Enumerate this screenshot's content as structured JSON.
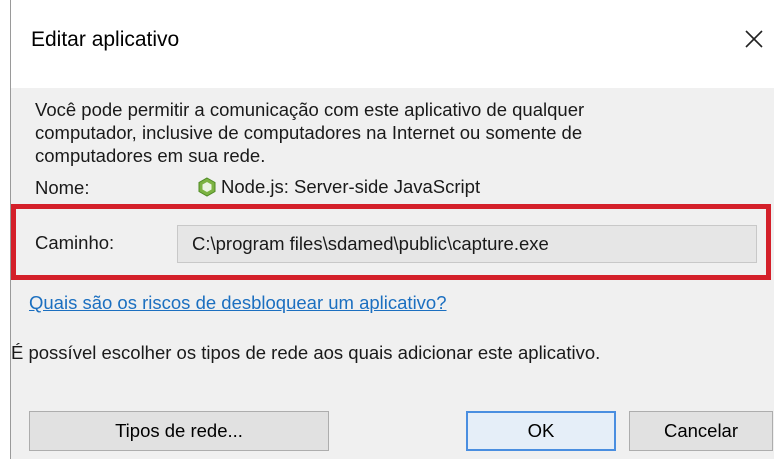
{
  "window": {
    "title": "Editar aplicativo",
    "close_icon": "close-icon"
  },
  "description": {
    "lines": [
      "Você pode permitir a comunicação com este aplicativo de qualquer",
      "computador, inclusive de computadores na Internet ou somente de",
      "computadores em sua rede."
    ]
  },
  "app": {
    "name_label": "Nome:",
    "name_value": "Node.js: Server-side JavaScript",
    "icon": "nodejs-icon",
    "path_label": "Caminho:",
    "path_value": "C:\\program files\\sdamed\\public\\capture.exe"
  },
  "links": {
    "risk": "Quais são os riscos de desbloquear um aplicativo?"
  },
  "info": {
    "network_text": "É possível escolher os tipos de rede aos quais adicionar este aplicativo."
  },
  "buttons": {
    "network_types": "Tipos de rede...",
    "ok": "OK",
    "cancel": "Cancelar"
  },
  "colors": {
    "highlight_border": "#d4202a",
    "link": "#1b6fc0",
    "ok_border": "#4a8ee0"
  }
}
